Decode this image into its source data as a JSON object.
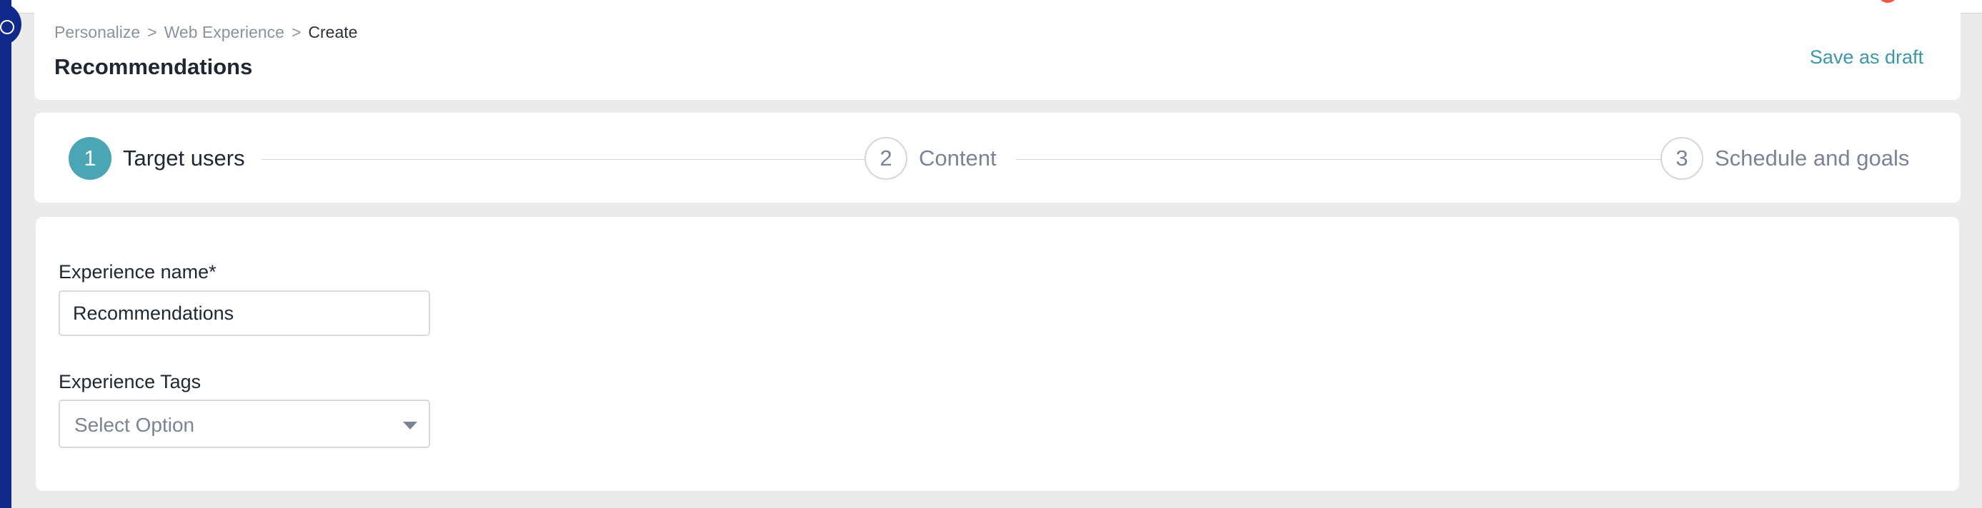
{
  "breadcrumb": {
    "items": [
      "Personalize",
      "Web Experience",
      "Create"
    ],
    "separator": ">"
  },
  "header": {
    "title": "Recommendations",
    "save_draft_label": "Save as draft"
  },
  "stepper": {
    "steps": [
      {
        "number": "1",
        "label": "Target users",
        "state": "active"
      },
      {
        "number": "2",
        "label": "Content",
        "state": "inactive"
      },
      {
        "number": "3",
        "label": "Schedule and goals",
        "state": "inactive"
      }
    ]
  },
  "form": {
    "experience_name": {
      "label": "Experience name*",
      "value": "Recommendations"
    },
    "experience_tags": {
      "label": "Experience Tags",
      "placeholder": "Select Option"
    }
  },
  "colors": {
    "accent": "#4aa6b4",
    "link": "#3b98a8",
    "rail": "#0f2a8a",
    "notification": "#f0554a"
  },
  "icons": {
    "rail_toggle": "chevron-circle-icon",
    "select_caret": "caret-down-icon"
  }
}
